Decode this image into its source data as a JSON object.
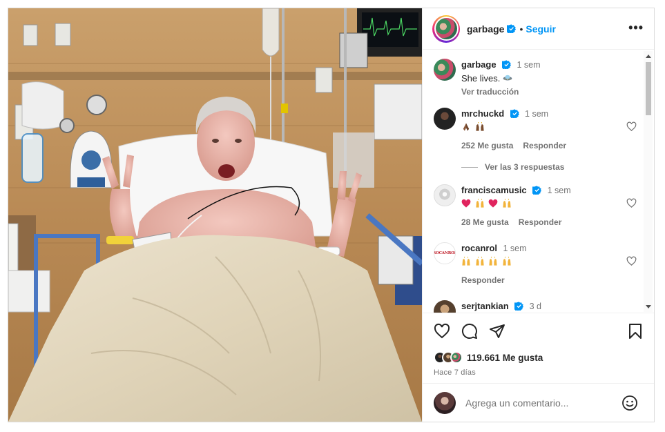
{
  "post": {
    "author": "garbage",
    "follow_label": "Seguir",
    "separator": "•",
    "more_label": "•••",
    "caption": {
      "username": "garbage",
      "time": "1 sem",
      "text": "She lives.",
      "translate_label": "Ver traducción"
    },
    "image_alt": "hospital bed photo"
  },
  "comments": [
    {
      "username": "mrchuckd",
      "time": "1 sem",
      "emojis": [
        "pray",
        "raise"
      ],
      "likes": "252 Me gusta",
      "reply_label": "Responder"
    },
    {
      "username": "franciscamusic",
      "time": "1 sem",
      "emojis": [
        "heart",
        "raise",
        "heart",
        "raise"
      ],
      "likes": "28 Me gusta",
      "reply_label": "Responder"
    },
    {
      "username": "rocanrol",
      "time": "1 sem",
      "emojis": [
        "raise",
        "raise",
        "raise",
        "raise"
      ],
      "likes": "",
      "reply_label": "Responder",
      "avatar_text": "ROCANROL"
    },
    {
      "username": "serjtankian",
      "time": "3 d"
    }
  ],
  "view_replies_label": "Ver las 3 respuestas",
  "stats": {
    "likes": "119.661 Me gusta",
    "posted": "Hace 7 días"
  },
  "composer": {
    "placeholder": "Agrega un comentario..."
  },
  "colors": {
    "accent": "#0095f6",
    "verified": "#0095f6",
    "text": "#262626",
    "muted": "#737373",
    "heart_red": "#e0245e"
  },
  "icons": [
    "verified-badge-icon",
    "more-icon",
    "heart-icon",
    "comment-icon",
    "share-icon",
    "save-icon",
    "emoji-icon"
  ]
}
